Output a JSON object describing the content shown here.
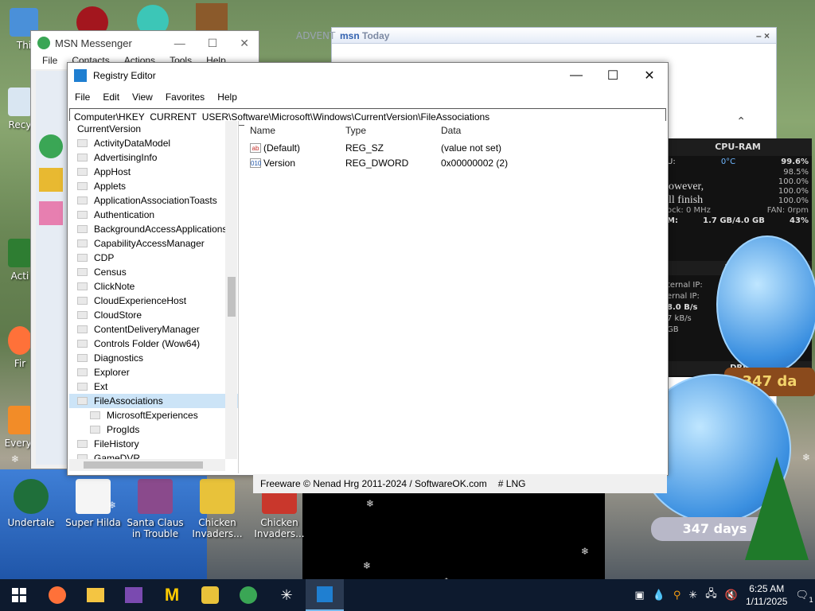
{
  "desktop_icons": [
    {
      "label": "Undertale"
    },
    {
      "label": "Super Hilda"
    },
    {
      "label": "Santa Claus in Trouble"
    },
    {
      "label": "Chicken Invaders..."
    },
    {
      "label": "Chicken Invaders..."
    }
  ],
  "left_edge_labels": {
    "recycle": "Recy",
    "activate": "Acti",
    "firefox": "Fir",
    "everything": "Everyt",
    "top": "Thi"
  },
  "msn": {
    "title": "MSN Messenger",
    "menu": [
      "File",
      "Contacts",
      "Actions",
      "Tools",
      "Help"
    ],
    "today_title": "Today",
    "advent_label": "ADVENT"
  },
  "registry": {
    "title": "Registry Editor",
    "menu": [
      "File",
      "Edit",
      "View",
      "Favorites",
      "Help"
    ],
    "address": "Computer\\HKEY_CURRENT_USER\\Software\\Microsoft\\Windows\\CurrentVersion\\FileAssociations",
    "tree": [
      {
        "label": "CurrentVersion",
        "level": 0
      },
      {
        "label": "ActivityDataModel",
        "level": 1
      },
      {
        "label": "AdvertisingInfo",
        "level": 1
      },
      {
        "label": "AppHost",
        "level": 1
      },
      {
        "label": "Applets",
        "level": 1
      },
      {
        "label": "ApplicationAssociationToasts",
        "level": 1
      },
      {
        "label": "Authentication",
        "level": 1
      },
      {
        "label": "BackgroundAccessApplications",
        "level": 1
      },
      {
        "label": "CapabilityAccessManager",
        "level": 1
      },
      {
        "label": "CDP",
        "level": 1
      },
      {
        "label": "Census",
        "level": 1
      },
      {
        "label": "ClickNote",
        "level": 1
      },
      {
        "label": "CloudExperienceHost",
        "level": 1
      },
      {
        "label": "CloudStore",
        "level": 1
      },
      {
        "label": "ContentDeliveryManager",
        "level": 1
      },
      {
        "label": "Controls Folder (Wow64)",
        "level": 1
      },
      {
        "label": "Diagnostics",
        "level": 1
      },
      {
        "label": "Explorer",
        "level": 1
      },
      {
        "label": "Ext",
        "level": 1
      },
      {
        "label": "FileAssociations",
        "level": 1,
        "selected": true
      },
      {
        "label": "MicrosoftExperiences",
        "level": 2
      },
      {
        "label": "ProgIds",
        "level": 2
      },
      {
        "label": "FileHistory",
        "level": 1
      },
      {
        "label": "GameDVR",
        "level": 1
      }
    ],
    "columns": [
      "Name",
      "Type",
      "Data"
    ],
    "values": [
      {
        "name": "(Default)",
        "type": "REG_SZ",
        "data": "(value not set)",
        "icon": "ab"
      },
      {
        "name": "Version",
        "type": "REG_DWORD",
        "data": "0x00000002 (2)",
        "icon": "010"
      }
    ],
    "status": {
      "text": "Freeware © Nenad Hrg 2011-2024 / SoftwareOK.com",
      "lng": "# LNG"
    }
  },
  "gadget": {
    "title": "CPU-RAM",
    "temp": "0°C",
    "cpu_total": "99.6%",
    "cores": [
      "98.5%",
      "100.0%",
      "100.0%",
      "100.0%"
    ],
    "clock": "ock: 0 MHz",
    "fan": "FAN: 0rpm",
    "mem": "1.7 GB/4.0 GB",
    "mem_pct": "43%",
    "overlay": [
      "owever,",
      "ll finish"
    ],
    "net_title": "NETW",
    "net_lines": [
      "ternal IP:",
      "ernal IP:",
      "8.0 B/s",
      "7 kB/s",
      "GB"
    ],
    "drive_title": "DRI"
  },
  "globes": {
    "days_top": "347 da",
    "days_bottom": "347 days"
  },
  "taskbar": {
    "time": "6:25 AM",
    "date": "1/11/2025",
    "notify_count": "1"
  }
}
